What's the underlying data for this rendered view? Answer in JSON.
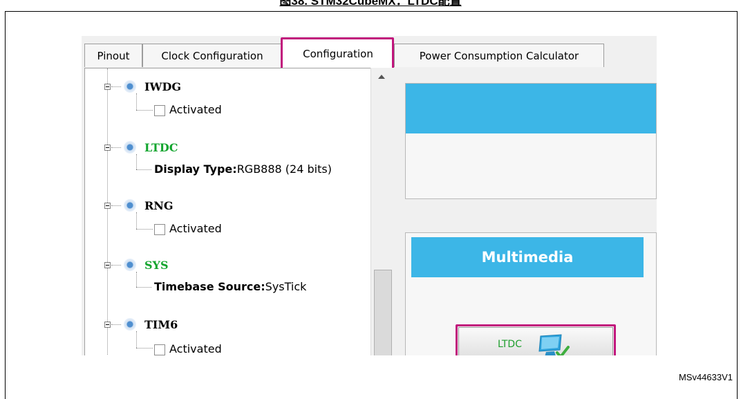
{
  "figure": {
    "caption": "图38. STM32CubeMX：LTDC配置",
    "reference": "MSv44633V1"
  },
  "tabs": [
    {
      "label": "Pinout",
      "active": false
    },
    {
      "label": "Clock Configuration",
      "active": false
    },
    {
      "label": "Configuration",
      "active": true
    },
    {
      "label": "Power Consumption Calculator",
      "active": false
    }
  ],
  "tree": [
    {
      "name": "IWDG",
      "child_kind": "checkbox",
      "child_label": "Activated",
      "checked": false,
      "color": "#000000"
    },
    {
      "name": "LTDC",
      "child_kind": "param",
      "param_name": "Display Type:",
      "param_value": "RGB888 (24 bits)",
      "color": "#12a52e"
    },
    {
      "name": "RNG",
      "child_kind": "checkbox",
      "child_label": "Activated",
      "checked": false,
      "color": "#000000"
    },
    {
      "name": "SYS",
      "child_kind": "param",
      "param_name": "Timebase Source:",
      "param_value": "SysTick",
      "color": "#12a52e"
    },
    {
      "name": "TIM6",
      "child_kind": "checkbox",
      "child_label": "Activated",
      "checked": false,
      "color": "#000000"
    }
  ],
  "right_panel": {
    "section_title": "Multimedia",
    "button_label": "LTDC",
    "button_icon": "monitor-check-icon",
    "accent_color": "#3cb6e7",
    "highlight_color": "#c1157c"
  }
}
